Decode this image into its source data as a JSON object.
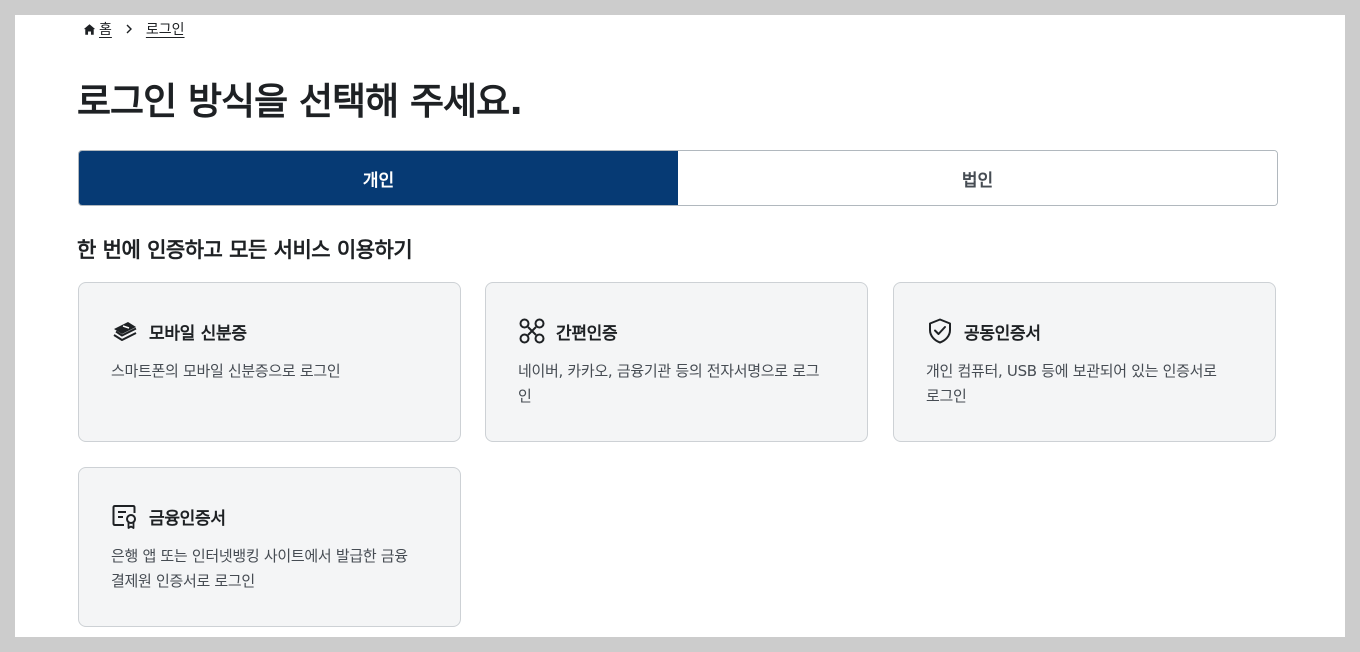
{
  "breadcrumb": {
    "home_label": "홈",
    "current_label": "로그인"
  },
  "page_title": "로그인 방식을 선택해 주세요.",
  "tabs": [
    {
      "label": "개인",
      "active": true
    },
    {
      "label": "법인",
      "active": false
    }
  ],
  "section_title": "한 번에 인증하고 모든 서비스 이용하기",
  "cards": [
    {
      "title": "모바일 신분증",
      "icon": "mobile-id-icon",
      "description": "스마트폰의 모바일 신분증으로 로그인"
    },
    {
      "title": "간편인증",
      "icon": "simple-auth-icon",
      "description": "네이버, 카카오, 금융기관 등의 전자서명으로 로그인"
    },
    {
      "title": "공동인증서",
      "icon": "shield-check-icon",
      "description": "개인 컴퓨터, USB 등에 보관되어 있는 인증서로 로그인"
    },
    {
      "title": "금융인증서",
      "icon": "certificate-icon",
      "description": "은행 앱 또는 인터넷뱅킹 사이트에서 발급한 금융결제원 인증서로 로그인"
    }
  ],
  "colors": {
    "accent": "#063a74",
    "card_bg": "#f4f5f6",
    "card_border": "#cdd1d5",
    "frame": "#cccccc"
  }
}
